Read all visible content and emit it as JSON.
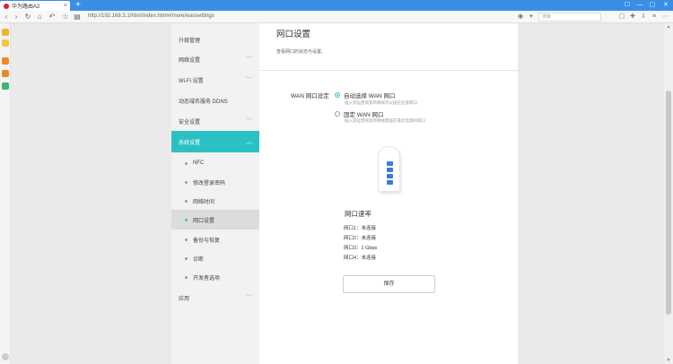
{
  "browser": {
    "tab_title": "华为路由A2",
    "new_tab": "+",
    "window_controls": [
      "☐",
      "—",
      "▢",
      "✕"
    ],
    "url": "http://192.168.3.1/html/index.html#/more/wansettings",
    "search_placeholder": "搜索"
  },
  "sidebar": {
    "items": [
      {
        "label": "升级管理"
      },
      {
        "label": "网络设置"
      },
      {
        "label": "Wi-Fi 设置"
      },
      {
        "label": "动态域名服务 DDNS"
      },
      {
        "label": "安全设置"
      },
      {
        "label": "系统设置"
      },
      {
        "label": "NFC"
      },
      {
        "label": "修改登录密码"
      },
      {
        "label": "网络时间"
      },
      {
        "label": "网口设置"
      },
      {
        "label": "备份与恢复"
      },
      {
        "label": "诊断"
      },
      {
        "label": "开发者选项"
      },
      {
        "label": "应用"
      }
    ]
  },
  "main": {
    "title": "网口设置",
    "description": "查看网口的状态与设置。",
    "wan_label": "WAN 网口设定",
    "options": [
      {
        "label": "自动选择 WAN 网口",
        "desc": "插入到运营商宽带网线可以插在任意网口",
        "selected": true
      },
      {
        "label": "固定 WAN 网口",
        "desc": "插入到运营商宽带网线需插在靠近电源的网口",
        "selected": false
      }
    ],
    "port_rate_title": "网口速率",
    "ports": [
      {
        "text": "网口1：未连接"
      },
      {
        "text": "网口2：未连接"
      },
      {
        "text": "网口3：1 Gbps"
      },
      {
        "text": "网口4：未连接"
      }
    ],
    "save_label": "保存"
  },
  "colors": {
    "accent": "#2bc1c4",
    "titlebar": "#3a8ee6"
  }
}
